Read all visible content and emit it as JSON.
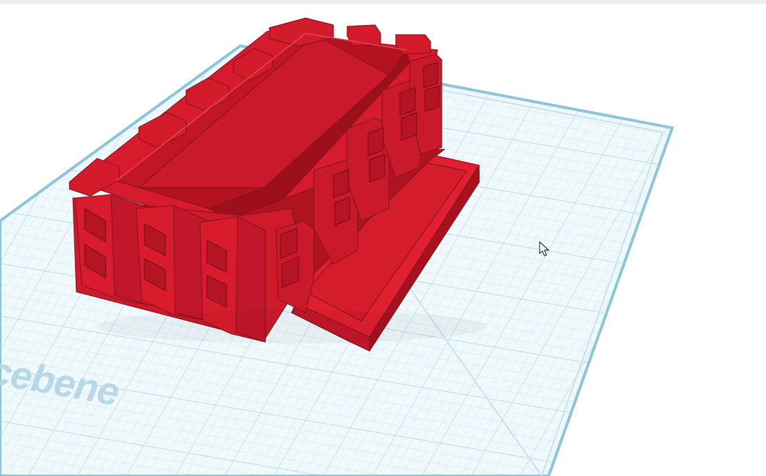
{
  "workplane": {
    "label": "cebene"
  },
  "colors": {
    "model": "#d41b2c",
    "grid_fill": "#eef7fb",
    "grid_minor": "#cfe5ef",
    "grid_major": "#a9d2e3",
    "plate_border": "#8fc6da"
  },
  "icons": {
    "cursor": "mouse-pointer-icon"
  }
}
